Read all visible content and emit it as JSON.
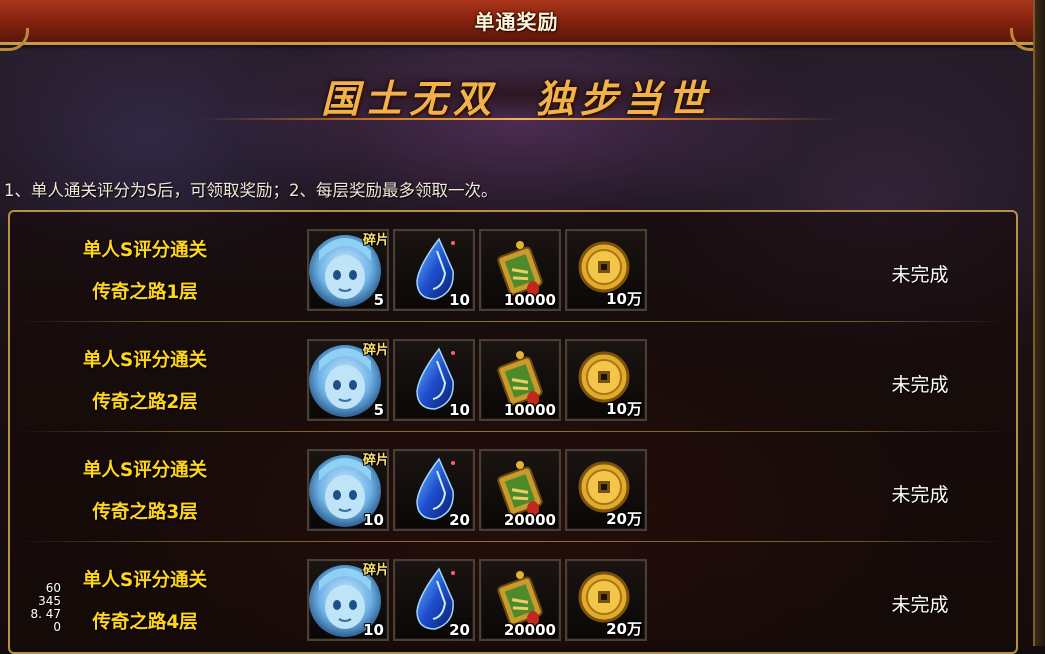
{
  "header": {
    "title": "单通奖励"
  },
  "banner": {
    "slogan": "国士无双  独步当世"
  },
  "rules_text": "1、单人通关评分为S后，可领取奖励；2、每层奖励最多领取一次。",
  "rows": [
    {
      "condition": "单人S评分通关",
      "floor": "传奇之路1层",
      "status": "未完成",
      "rewards": [
        {
          "icon": "hero-portrait-fragment-icon",
          "tag": "碎片",
          "qty": "5"
        },
        {
          "icon": "blue-crystal-icon",
          "qty": "10"
        },
        {
          "icon": "gold-scroll-icon",
          "qty": "10000"
        },
        {
          "icon": "gold-coin-icon",
          "qty": "10万"
        }
      ]
    },
    {
      "condition": "单人S评分通关",
      "floor": "传奇之路2层",
      "status": "未完成",
      "rewards": [
        {
          "icon": "hero-portrait-fragment-icon",
          "tag": "碎片",
          "qty": "5"
        },
        {
          "icon": "blue-crystal-icon",
          "qty": "10"
        },
        {
          "icon": "gold-scroll-icon",
          "qty": "10000"
        },
        {
          "icon": "gold-coin-icon",
          "qty": "10万"
        }
      ]
    },
    {
      "condition": "单人S评分通关",
      "floor": "传奇之路3层",
      "status": "未完成",
      "rewards": [
        {
          "icon": "hero-portrait-fragment-icon",
          "tag": "碎片",
          "qty": "10"
        },
        {
          "icon": "blue-crystal-icon",
          "qty": "20"
        },
        {
          "icon": "gold-scroll-icon",
          "qty": "20000"
        },
        {
          "icon": "gold-coin-icon",
          "qty": "20万"
        }
      ]
    },
    {
      "condition": "单人S评分通关",
      "floor": "传奇之路4层",
      "status": "未完成",
      "rewards": [
        {
          "icon": "hero-portrait-fragment-icon",
          "tag": "碎片",
          "qty": "10"
        },
        {
          "icon": "blue-crystal-icon",
          "qty": "20"
        },
        {
          "icon": "gold-scroll-icon",
          "qty": "20000"
        },
        {
          "icon": "gold-coin-icon",
          "qty": "20万"
        }
      ]
    }
  ],
  "debug_overlay": {
    "line1": "60",
    "line2": "345",
    "line3": "8. 47",
    "line4": "0"
  },
  "colors": {
    "title_bar": "#8a2410",
    "condition_text": "#ffd51c",
    "slogan": "#f2b24a",
    "panel_border": "#b8903f"
  }
}
